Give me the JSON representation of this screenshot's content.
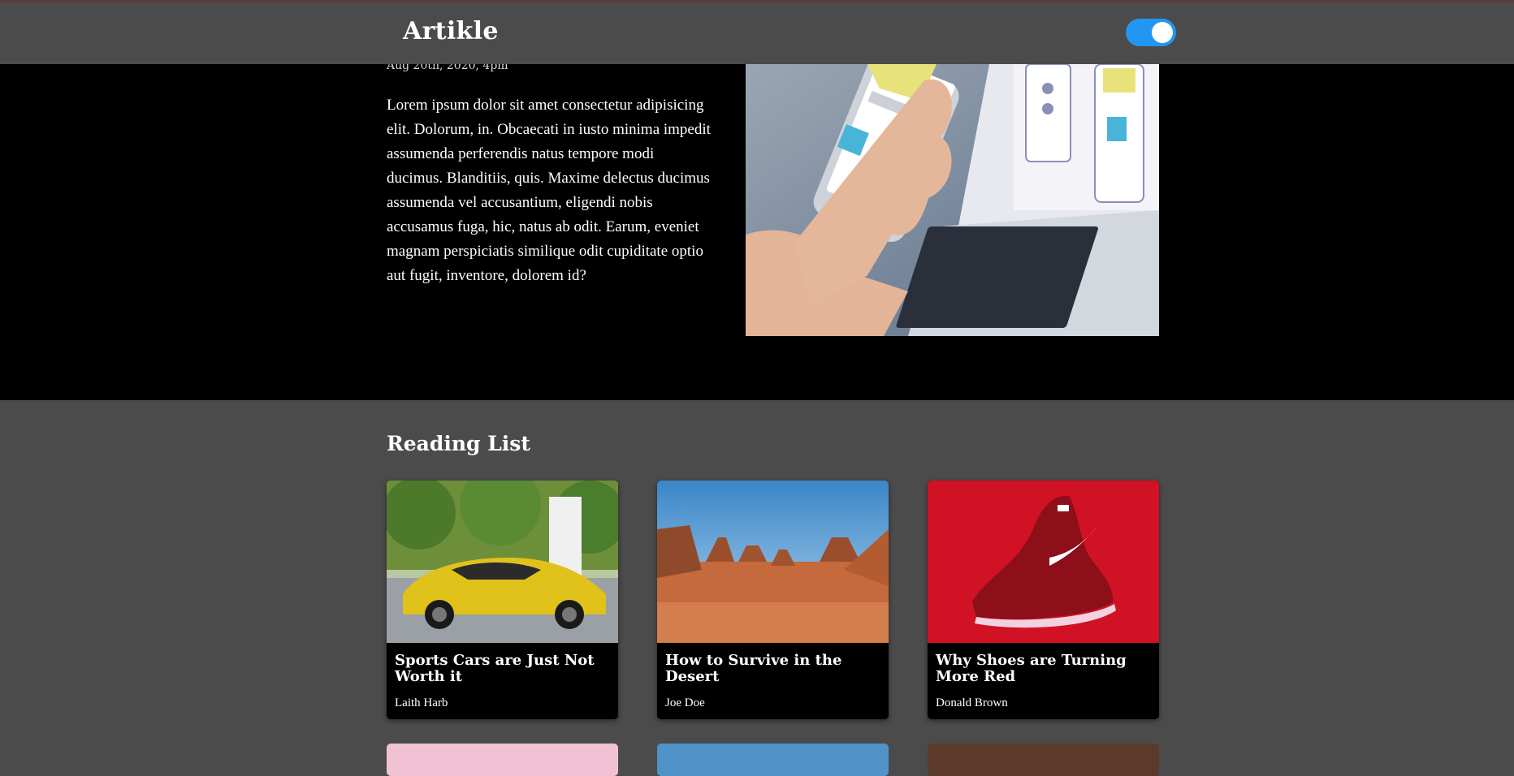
{
  "app": {
    "title": "Artikle"
  },
  "header": {
    "logo": "Artikle",
    "theme_toggle": {
      "state": "on",
      "color": "#2196f3"
    }
  },
  "hero": {
    "date_partial": "Aug 20th, 2020, 4pm",
    "body": "Lorem ipsum dolor sit amet consectetur adipisicing elit. Dolorum, in. Obcaecati in iusto minima impedit assumenda perferendis natus tempore modi ducimus. Blanditiis, quis. Maxime delectus ducimus assumenda vel accusantium, eligendi nobis accusamus fuga, hic, natus ab odit. Earum, eveniet magnam perspiciatis similique odit cupiditate optio aut fugit, inventore, dolorem id?"
  },
  "reading_list": {
    "title": "Reading List",
    "cards": [
      {
        "title": "Sports Cars are Just Not Worth it",
        "author": "Laith Harb",
        "image": "yellow-sports-car-image"
      },
      {
        "title": "How to Survive in the Desert",
        "author": "Joe Doe",
        "image": "desert-landscape-image"
      },
      {
        "title": "Why Shoes are Turning More Red",
        "author": "Donald Brown",
        "image": "red-shoe-image"
      }
    ]
  },
  "colors": {
    "header_bg": "#4b4b4b",
    "hero_bg": "#000000",
    "page_bg": "#4b4b4b",
    "accent": "#2196f3"
  }
}
